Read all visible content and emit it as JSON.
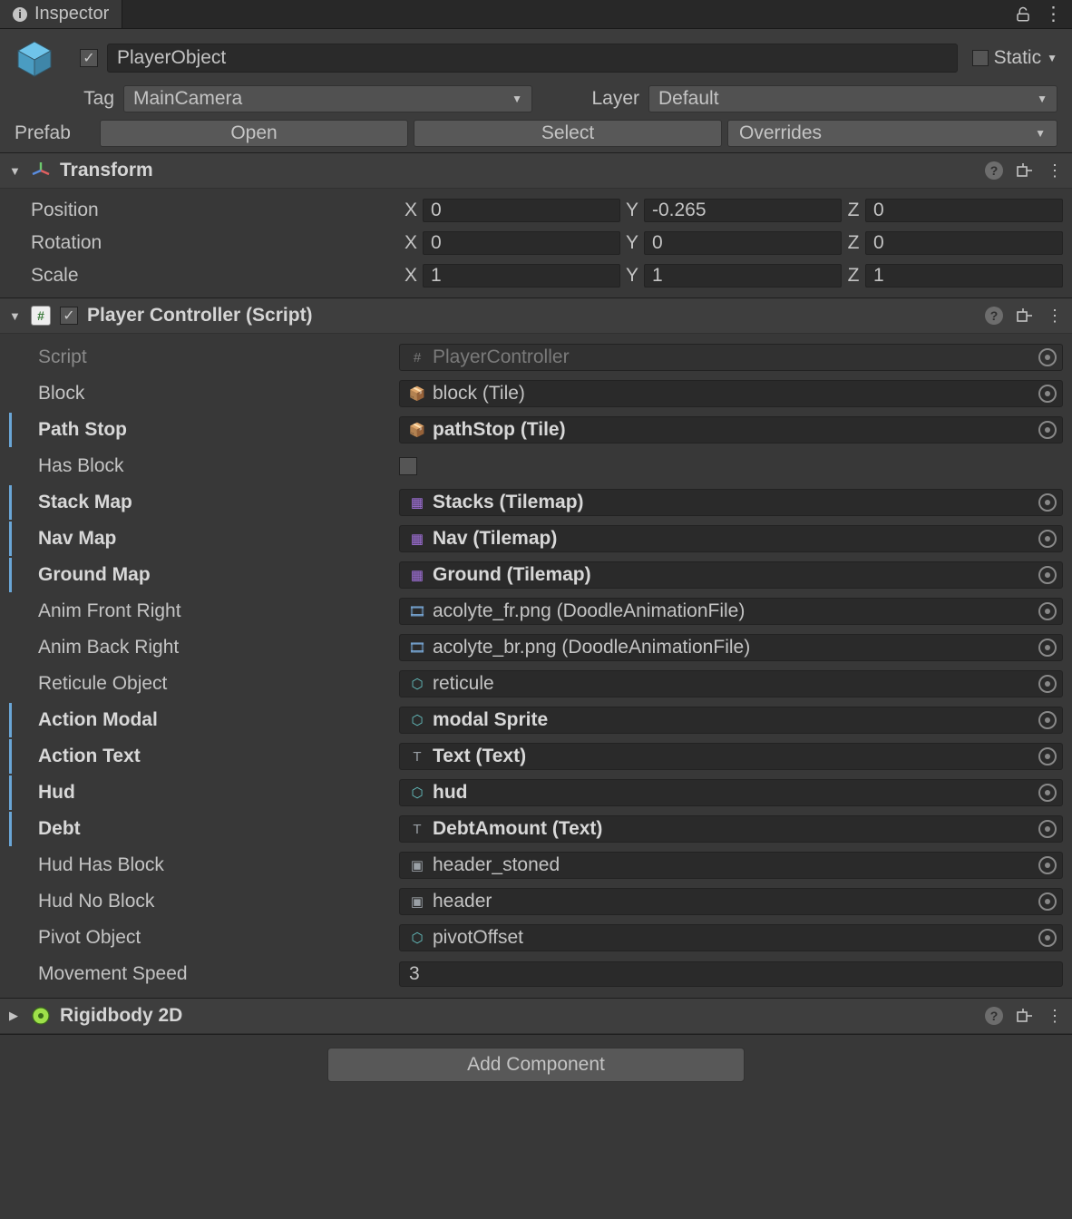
{
  "tab": {
    "title": "Inspector"
  },
  "header": {
    "name": "PlayerObject",
    "active": true,
    "static_label": "Static",
    "static": false,
    "tag_label": "Tag",
    "tag_value": "MainCamera",
    "layer_label": "Layer",
    "layer_value": "Default",
    "prefab_label": "Prefab",
    "open_label": "Open",
    "select_label": "Select",
    "overrides_label": "Overrides"
  },
  "transform": {
    "title": "Transform",
    "position_label": "Position",
    "rotation_label": "Rotation",
    "scale_label": "Scale",
    "position": {
      "x": "0",
      "y": "-0.265",
      "z": "0"
    },
    "rotation": {
      "x": "0",
      "y": "0",
      "z": "0"
    },
    "scale": {
      "x": "1",
      "y": "1",
      "z": "1"
    }
  },
  "playerController": {
    "title": "Player Controller (Script)",
    "enabled": true,
    "script_label": "Script",
    "script_value": "PlayerController",
    "props": [
      {
        "label": "Block",
        "value": "block (Tile)",
        "bold": false,
        "override": false,
        "icon": "asset-icon",
        "objField": true
      },
      {
        "label": "Path Stop",
        "value": "pathStop (Tile)",
        "bold": true,
        "override": true,
        "icon": "asset-icon",
        "objField": true
      },
      {
        "label": "Has Block",
        "value": "",
        "bold": false,
        "override": false,
        "icon": "",
        "checkbox": true
      },
      {
        "label": "Stack Map",
        "value": "Stacks (Tilemap)",
        "bold": true,
        "override": true,
        "icon": "tilemap-icon",
        "objField": true
      },
      {
        "label": "Nav Map",
        "value": "Nav (Tilemap)",
        "bold": true,
        "override": true,
        "icon": "tilemap-icon",
        "objField": true
      },
      {
        "label": "Ground Map",
        "value": "Ground (Tilemap)",
        "bold": true,
        "override": true,
        "icon": "tilemap-icon",
        "objField": true
      },
      {
        "label": "Anim Front Right",
        "value": "acolyte_fr.png (DoodleAnimationFile)",
        "bold": false,
        "override": false,
        "icon": "anim-icon",
        "objField": true
      },
      {
        "label": "Anim Back Right",
        "value": "acolyte_br.png (DoodleAnimationFile)",
        "bold": false,
        "override": false,
        "icon": "anim-icon",
        "objField": true
      },
      {
        "label": "Reticule Object",
        "value": "reticule",
        "bold": false,
        "override": false,
        "icon": "cube-icon",
        "objField": true
      },
      {
        "label": "Action Modal",
        "value": "modal Sprite",
        "bold": true,
        "override": true,
        "icon": "cube-icon",
        "objField": true
      },
      {
        "label": "Action Text",
        "value": "Text (Text)",
        "bold": true,
        "override": true,
        "icon": "text-icon",
        "objField": true
      },
      {
        "label": "Hud",
        "value": "hud",
        "bold": true,
        "override": true,
        "icon": "cube-icon",
        "objField": true
      },
      {
        "label": "Debt",
        "value": "DebtAmount (Text)",
        "bold": true,
        "override": true,
        "icon": "text-icon",
        "objField": true
      },
      {
        "label": "Hud Has Block",
        "value": "header_stoned",
        "bold": false,
        "override": false,
        "icon": "image-icon",
        "objField": true
      },
      {
        "label": "Hud No Block",
        "value": "header",
        "bold": false,
        "override": false,
        "icon": "image-icon",
        "objField": true
      },
      {
        "label": "Pivot Object",
        "value": "pivotOffset",
        "bold": false,
        "override": false,
        "icon": "cube-icon",
        "objField": true
      },
      {
        "label": "Movement Speed",
        "value": "3",
        "bold": false,
        "override": false,
        "icon": "",
        "plain": true
      }
    ]
  },
  "rigidbody": {
    "title": "Rigidbody 2D"
  },
  "add_component": "Add Component",
  "icons": {
    "asset-icon": "📦",
    "tilemap-icon": "▦",
    "anim-icon": "🎞",
    "cube-icon": "⬡",
    "text-icon": "T",
    "image-icon": "▣"
  },
  "colors": {
    "asset-icon": "#b565d4",
    "tilemap-icon": "#a573e0",
    "anim-icon": "#7fb3e6",
    "cube-icon": "#66c2c2",
    "text-icon": "#9aa0a6",
    "image-icon": "#9aa0a6"
  }
}
